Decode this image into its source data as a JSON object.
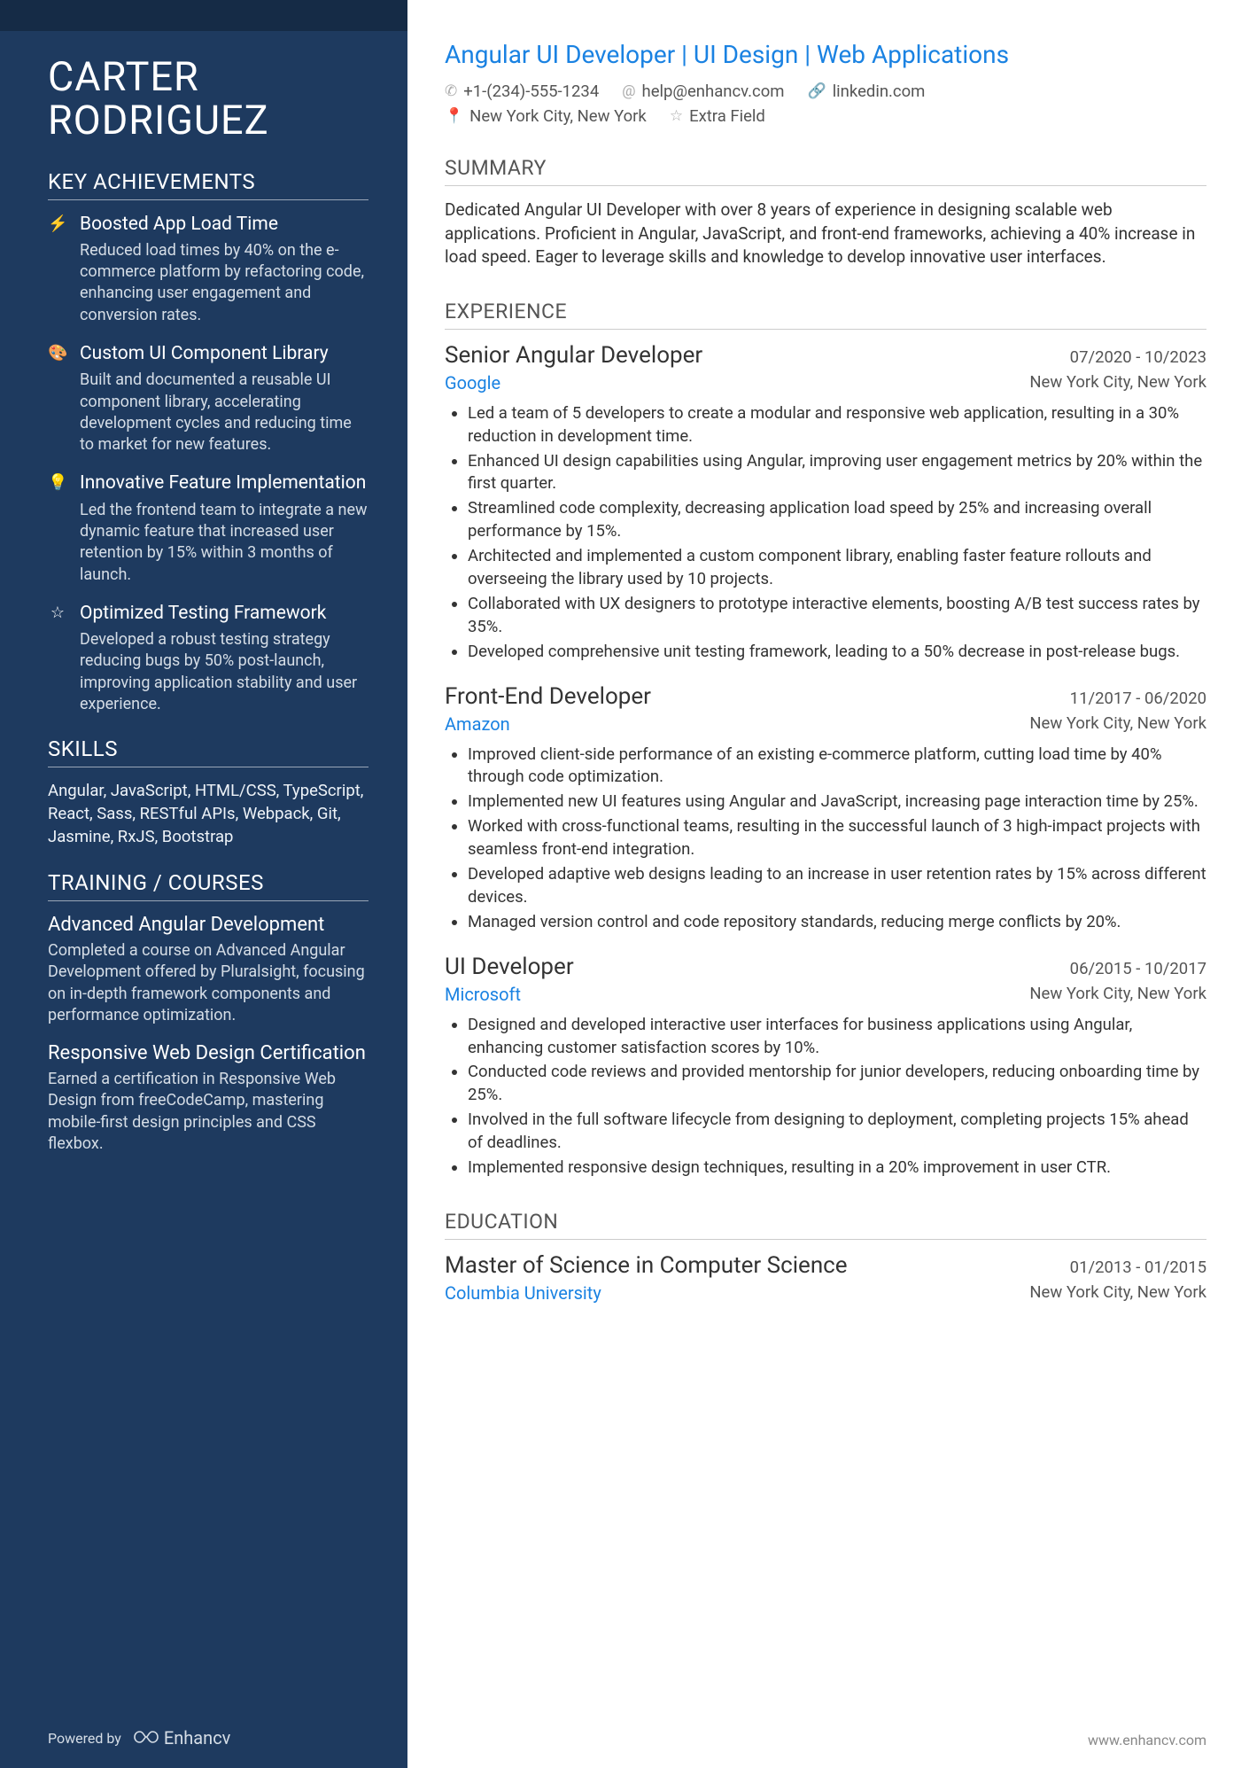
{
  "name": "CARTER RODRIGUEZ",
  "headline": "Angular UI Developer | UI Design | Web Applications",
  "contacts": {
    "phone": "+1-(234)-555-1234",
    "email": "help@enhancv.com",
    "link": "linkedin.com",
    "location": "New York City, New York",
    "extra": "Extra Field"
  },
  "sections": {
    "achievements_title": "KEY ACHIEVEMENTS",
    "skills_title": "SKILLS",
    "training_title": "TRAINING / COURSES",
    "summary_title": "SUMMARY",
    "experience_title": "EXPERIENCE",
    "education_title": "EDUCATION"
  },
  "achievements": [
    {
      "icon": "⚡",
      "title": "Boosted App Load Time",
      "desc": "Reduced load times by 40% on the e-commerce platform by refactoring code, enhancing user engagement and conversion rates."
    },
    {
      "icon": "🎨",
      "title": "Custom UI Component Library",
      "desc": "Built and documented a reusable UI component library, accelerating development cycles and reducing time to market for new features."
    },
    {
      "icon": "💡",
      "title": "Innovative Feature Implementation",
      "desc": "Led the frontend team to integrate a new dynamic feature that increased user retention by 15% within 3 months of launch."
    },
    {
      "icon": "☆",
      "title": "Optimized Testing Framework",
      "desc": "Developed a robust testing strategy reducing bugs by 50% post-launch, improving application stability and user experience."
    }
  ],
  "skills": "Angular, JavaScript, HTML/CSS, TypeScript, React, Sass, RESTful APIs, Webpack, Git, Jasmine, RxJS, Bootstrap",
  "training": [
    {
      "title": "Advanced Angular Development",
      "desc": "Completed a course on Advanced Angular Development offered by Pluralsight, focusing on in-depth framework components and performance optimization."
    },
    {
      "title": "Responsive Web Design Certification",
      "desc": "Earned a certification in Responsive Web Design from freeCodeCamp, mastering mobile-first design principles and CSS flexbox."
    }
  ],
  "summary": "Dedicated Angular UI Developer with over 8 years of experience in designing scalable web applications. Proficient in Angular, JavaScript, and front-end frameworks, achieving a 40% increase in load speed. Eager to leverage skills and knowledge to develop innovative user interfaces.",
  "experience": [
    {
      "title": "Senior Angular Developer",
      "company": "Google",
      "dates": "07/2020 - 10/2023",
      "location": "New York City, New York",
      "bullets": [
        "Led a team of 5 developers to create a modular and responsive web application, resulting in a 30% reduction in development time.",
        "Enhanced UI design capabilities using Angular, improving user engagement metrics by 20% within the first quarter.",
        "Streamlined code complexity, decreasing application load speed by 25% and increasing overall performance by 15%.",
        "Architected and implemented a custom component library, enabling faster feature rollouts and overseeing the library used by 10 projects.",
        "Collaborated with UX designers to prototype interactive elements, boosting A/B test success rates by 35%.",
        "Developed comprehensive unit testing framework, leading to a 50% decrease in post-release bugs."
      ]
    },
    {
      "title": "Front-End Developer",
      "company": "Amazon",
      "dates": "11/2017 - 06/2020",
      "location": "New York City, New York",
      "bullets": [
        "Improved client-side performance of an existing e-commerce platform, cutting load time by 40% through code optimization.",
        "Implemented new UI features using Angular and JavaScript, increasing page interaction time by 25%.",
        "Worked with cross-functional teams, resulting in the successful launch of 3 high-impact projects with seamless front-end integration.",
        "Developed adaptive web designs leading to an increase in user retention rates by 15% across different devices.",
        "Managed version control and code repository standards, reducing merge conflicts by 20%."
      ]
    },
    {
      "title": "UI Developer",
      "company": "Microsoft",
      "dates": "06/2015 - 10/2017",
      "location": "New York City, New York",
      "bullets": [
        "Designed and developed interactive user interfaces for business applications using Angular, enhancing customer satisfaction scores by 10%.",
        "Conducted code reviews and provided mentorship for junior developers, reducing onboarding time by 25%.",
        "Involved in the full software lifecycle from designing to deployment, completing projects 15% ahead of deadlines.",
        "Implemented responsive design techniques, resulting in a 20% improvement in user CTR."
      ]
    }
  ],
  "education": [
    {
      "title": "Master of Science in Computer Science",
      "company": "Columbia University",
      "dates": "01/2013 - 01/2015",
      "location": "New York City, New York"
    }
  ],
  "footer": {
    "powered_by": "Powered by",
    "brand": "Enhancv",
    "url": "www.enhancv.com"
  }
}
